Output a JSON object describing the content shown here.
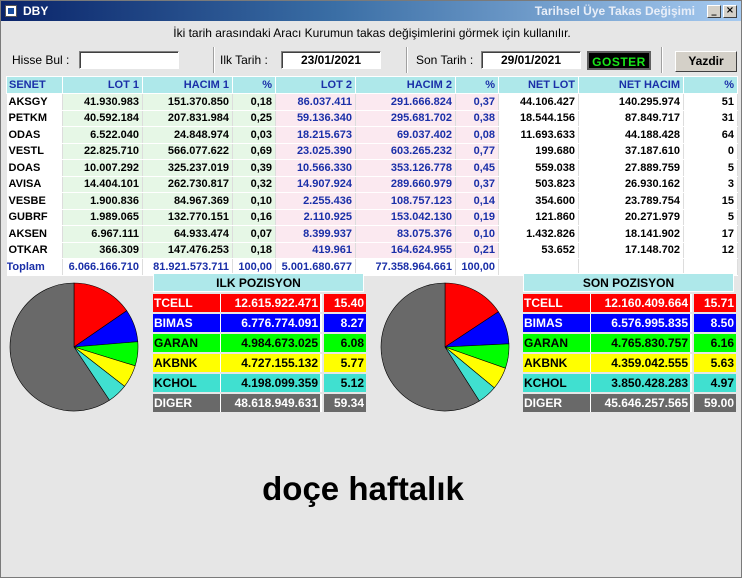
{
  "window": {
    "app_name": "DBY",
    "caption": "Tarihsel Üye Takas Değişimi"
  },
  "info": "İki tarih arasındaki Aracı Kurumun takas değişimlerini görmek için kullanılır.",
  "toolbar": {
    "hisse_label": "Hisse Bul :",
    "hisse_value": "",
    "ilk_label": "Ilk Tarih :",
    "ilk_value": "23/01/2021",
    "son_label": "Son Tarih :",
    "son_value": "29/01/2021",
    "goster": "GOSTER",
    "yazdir": "Yazdir"
  },
  "grid": {
    "headers": [
      "SENET",
      "LOT 1",
      "HACIM 1",
      "%",
      "LOT 2",
      "HACIM 2",
      "%",
      "NET LOT",
      "NET HACIM",
      "%"
    ],
    "rows": [
      [
        "AKSGY",
        "41.930.983",
        "151.370.850",
        "0,18",
        "86.037.411",
        "291.666.824",
        "0,37",
        "44.106.427",
        "140.295.974",
        "51"
      ],
      [
        "PETKM",
        "40.592.184",
        "207.831.984",
        "0,25",
        "59.136.340",
        "295.681.702",
        "0,38",
        "18.544.156",
        "87.849.717",
        "31"
      ],
      [
        "ODAS",
        "6.522.040",
        "24.848.974",
        "0,03",
        "18.215.673",
        "69.037.402",
        "0,08",
        "11.693.633",
        "44.188.428",
        "64"
      ],
      [
        "VESTL",
        "22.825.710",
        "566.077.622",
        "0,69",
        "23.025.390",
        "603.265.232",
        "0,77",
        "199.680",
        "37.187.610",
        "0"
      ],
      [
        "DOAS",
        "10.007.292",
        "325.237.019",
        "0,39",
        "10.566.330",
        "353.126.778",
        "0,45",
        "559.038",
        "27.889.759",
        "5"
      ],
      [
        "AVISA",
        "14.404.101",
        "262.730.817",
        "0,32",
        "14.907.924",
        "289.660.979",
        "0,37",
        "503.823",
        "26.930.162",
        "3"
      ],
      [
        "VESBE",
        "1.900.836",
        "84.967.369",
        "0,10",
        "2.255.436",
        "108.757.123",
        "0,14",
        "354.600",
        "23.789.754",
        "15"
      ],
      [
        "GUBRF",
        "1.989.065",
        "132.770.151",
        "0,16",
        "2.110.925",
        "153.042.130",
        "0,19",
        "121.860",
        "20.271.979",
        "5"
      ],
      [
        "AKSEN",
        "6.967.111",
        "64.933.474",
        "0,07",
        "8.399.937",
        "83.075.376",
        "0,10",
        "1.432.826",
        "18.141.902",
        "17"
      ],
      [
        "OTKAR",
        "366.309",
        "147.476.253",
        "0,18",
        "419.961",
        "164.624.955",
        "0,21",
        "53.652",
        "17.148.702",
        "12"
      ]
    ],
    "total": [
      "Toplam",
      "6.066.166.710",
      "81.921.573.711",
      "100,00",
      "5.001.680.677",
      "77.358.964.661",
      "100,00",
      "",
      "",
      ""
    ]
  },
  "ilk": {
    "title": "ILK POZISYON",
    "items": [
      {
        "name": "TCELL",
        "value": "12.615.922.471",
        "pct": "15.40",
        "share": 15.4,
        "color": "#ff0000"
      },
      {
        "name": "BIMAS",
        "value": "6.776.774.091",
        "pct": "8.27",
        "share": 8.27,
        "color": "#0000ff"
      },
      {
        "name": "GARAN",
        "value": "4.984.673.025",
        "pct": "6.08",
        "share": 6.08,
        "color": "#00ff00"
      },
      {
        "name": "AKBNK",
        "value": "4.727.155.132",
        "pct": "5.77",
        "share": 5.77,
        "color": "#ffff00"
      },
      {
        "name": "KCHOL",
        "value": "4.198.099.359",
        "pct": "5.12",
        "share": 5.12,
        "color": "#40e0d0"
      },
      {
        "name": "DIGER",
        "value": "48.618.949.631",
        "pct": "59.34",
        "share": 59.34,
        "color": "#696969"
      }
    ]
  },
  "son": {
    "title": "SON POZISYON",
    "items": [
      {
        "name": "TCELL",
        "value": "12.160.409.664",
        "pct": "15.71",
        "share": 15.71,
        "color": "#ff0000"
      },
      {
        "name": "BIMAS",
        "value": "6.576.995.835",
        "pct": "8.50",
        "share": 8.5,
        "color": "#0000ff"
      },
      {
        "name": "GARAN",
        "value": "4.765.830.757",
        "pct": "6.16",
        "share": 6.16,
        "color": "#00ff00"
      },
      {
        "name": "AKBNK",
        "value": "4.359.042.555",
        "pct": "5.63",
        "share": 5.63,
        "color": "#ffff00"
      },
      {
        "name": "KCHOL",
        "value": "3.850.428.283",
        "pct": "4.97",
        "share": 4.97,
        "color": "#40e0d0"
      },
      {
        "name": "DIGER",
        "value": "45.646.257.565",
        "pct": "59.00",
        "share": 59.0,
        "color": "#696969"
      }
    ]
  },
  "caption_text": "doçe haftalık"
}
